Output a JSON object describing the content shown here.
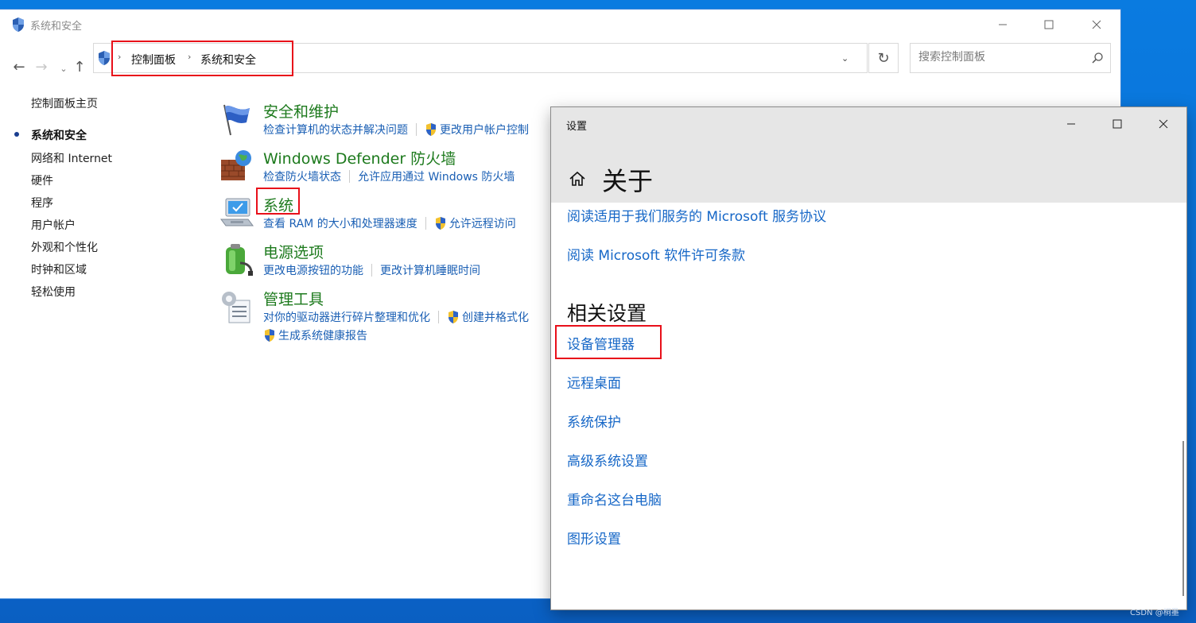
{
  "control_panel": {
    "title": "系统和安全",
    "window_controls": {
      "minimize": "—",
      "maximize": "☐",
      "close": "✕"
    },
    "nav": {
      "back": "←",
      "forward": "→",
      "history": "⌄",
      "up": "↑"
    },
    "breadcrumb": [
      "控制面板",
      "系统和安全"
    ],
    "breadcrumb_separator": "›",
    "address_dropdown": "⌄",
    "refresh": "↻",
    "search": {
      "placeholder": "搜索控制面板",
      "value": ""
    },
    "left_nav": {
      "home": "控制面板主页",
      "items": [
        {
          "label": "系统和安全",
          "active": true
        },
        {
          "label": "网络和 Internet"
        },
        {
          "label": "硬件"
        },
        {
          "label": "程序"
        },
        {
          "label": "用户帐户"
        },
        {
          "label": "外观和个性化"
        },
        {
          "label": "时钟和区域"
        },
        {
          "label": "轻松使用"
        }
      ]
    },
    "categories": [
      {
        "title": "安全和维护",
        "icon": "flag-icon",
        "links": [
          "检查计算机的状态并解决问题",
          "更改用户帐户控制"
        ]
      },
      {
        "title": "Windows Defender 防火墙",
        "icon": "firewall-icon",
        "links": [
          "检查防火墙状态",
          "允许应用通过 Windows 防火墙"
        ]
      },
      {
        "title": "系统",
        "icon": "computer-icon",
        "links": [
          "查看 RAM 的大小和处理器速度",
          "允许远程访问"
        ]
      },
      {
        "title": "电源选项",
        "icon": "battery-icon",
        "links": [
          "更改电源按钮的功能",
          "更改计算机睡眠时间"
        ]
      },
      {
        "title": "管理工具",
        "icon": "admin-tools-icon",
        "links": [
          "对你的驱动器进行碎片整理和优化",
          "创建并格式化",
          "生成系统健康报告"
        ]
      }
    ]
  },
  "settings": {
    "window_title": "设置",
    "window_controls": {
      "minimize": "—",
      "maximize": "☐",
      "close": "✕"
    },
    "page_title": "关于",
    "links_top": [
      "阅读适用于我们服务的 Microsoft 服务协议",
      "阅读 Microsoft 软件许可条款"
    ],
    "related_heading": "相关设置",
    "related_links": [
      "设备管理器",
      "远程桌面",
      "系统保护",
      "高级系统设置",
      "重命名这台电脑",
      "图形设置"
    ]
  },
  "watermark": "CSDN @桐墨",
  "colors": {
    "accent_link": "#1667c7",
    "category_title": "#1d7a1d",
    "highlight_box": "#e8101a",
    "desktop": "#0b6fd6"
  }
}
